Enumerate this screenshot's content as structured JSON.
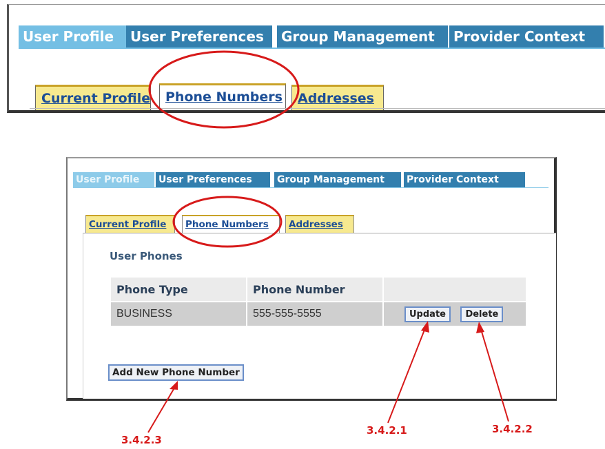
{
  "top_panel": {
    "main_tabs": [
      {
        "label": "User Profile",
        "selected": true
      },
      {
        "label": "User Preferences",
        "selected": false
      },
      {
        "label": "Group Management",
        "selected": false
      },
      {
        "label": "Provider Context",
        "selected": false
      }
    ],
    "sub_tabs": [
      {
        "label": "Current Profile",
        "selected": false
      },
      {
        "label": "Phone Numbers",
        "selected": true
      },
      {
        "label": "Addresses",
        "selected": false
      }
    ]
  },
  "bottom_panel": {
    "main_tabs": [
      {
        "label": "User Profile",
        "selected": true
      },
      {
        "label": "User Preferences",
        "selected": false
      },
      {
        "label": "Group Management",
        "selected": false
      },
      {
        "label": "Provider Context",
        "selected": false
      }
    ],
    "sub_tabs": [
      {
        "label": "Current Profile",
        "selected": false
      },
      {
        "label": "Phone Numbers",
        "selected": true
      },
      {
        "label": "Addresses",
        "selected": false
      }
    ],
    "section_title": "User Phones",
    "table": {
      "headers": [
        "Phone Type",
        "Phone Number",
        ""
      ],
      "rows": [
        {
          "type": "BUSINESS",
          "number": "555-555-5555",
          "update_label": "Update",
          "delete_label": "Delete"
        }
      ]
    },
    "add_button_label": "Add New Phone Number"
  },
  "annotations": {
    "update": "3.4.2.1",
    "delete": "3.4.2.2",
    "add": "3.4.2.3",
    "color": "#d71a1a"
  },
  "colors": {
    "main_tab_selected": "#74bfe4",
    "main_tab_unselected": "#337fae",
    "sub_tab_unselected": "#f7e98f",
    "highlight_ellipse": "#d71a1a"
  }
}
